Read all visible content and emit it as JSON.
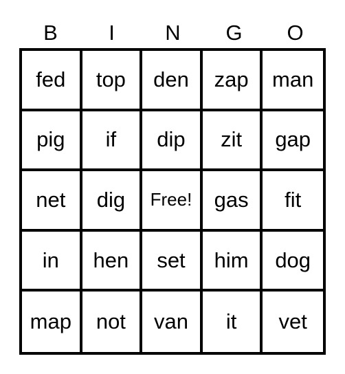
{
  "header": [
    "B",
    "I",
    "N",
    "G",
    "O"
  ],
  "rows": [
    [
      "fed",
      "top",
      "den",
      "zap",
      "man"
    ],
    [
      "pig",
      "if",
      "dip",
      "zit",
      "gap"
    ],
    [
      "net",
      "dig",
      "Free!",
      "gas",
      "fit"
    ],
    [
      "in",
      "hen",
      "set",
      "him",
      "dog"
    ],
    [
      "map",
      "not",
      "van",
      "it",
      "vet"
    ]
  ]
}
